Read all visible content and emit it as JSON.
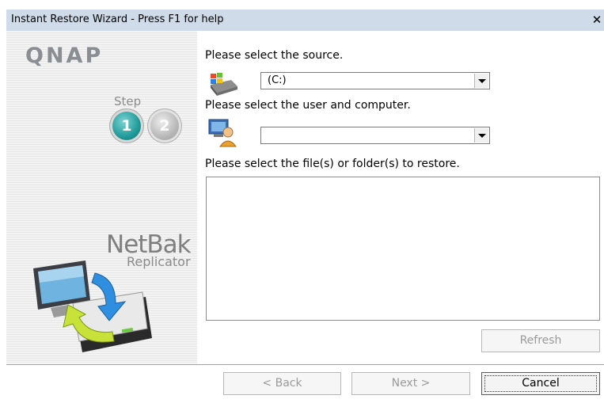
{
  "window": {
    "title": "Instant Restore Wizard - Press F1 for help",
    "close_glyph": "✕"
  },
  "sidebar": {
    "logo": "QNAP",
    "step_label": "Step",
    "steps": [
      "1",
      "2"
    ],
    "current_step": 1,
    "product_name": "NetBak",
    "product_sub": "Replicator"
  },
  "main": {
    "source_prompt": "Please select the source.",
    "source_value": "(C:)",
    "user_prompt": "Please select the user and computer.",
    "user_value": "",
    "files_prompt": "Please select the file(s) or folder(s) to restore.",
    "refresh_label": "Refresh"
  },
  "footer": {
    "back_label": "< Back",
    "next_label": "Next >",
    "cancel_label": "Cancel"
  },
  "icons": {
    "source": "drive-icon",
    "user": "user-computer-icon",
    "product": "monitor-drive-sync-icon"
  },
  "colors": {
    "titlebar": "#cfdbe8",
    "step_active": "#1f9b9a",
    "step_inactive": "#b9b9b9"
  }
}
